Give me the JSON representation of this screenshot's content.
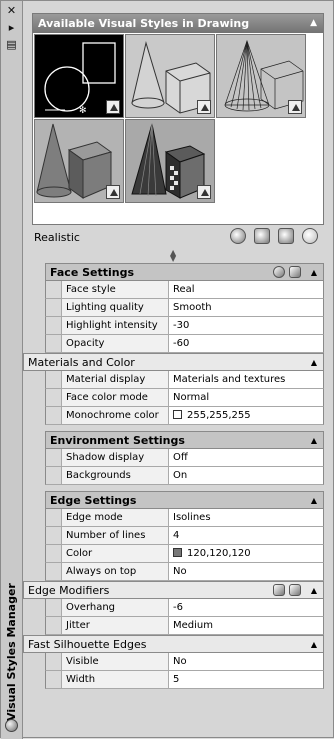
{
  "palette": {
    "title": "Visual Styles Manager",
    "close_glyph": "✕",
    "autohide_glyph": "▸",
    "menu_glyph": "▤"
  },
  "gallery": {
    "title": "Available Visual Styles in Drawing",
    "collapse_glyph": "▲",
    "selected_style": "Realistic",
    "thumbnails": [
      {
        "name": "2D Wireframe",
        "icon": "wireframe-2d-thumbnail",
        "selected": true
      },
      {
        "name": "3D Hidden",
        "icon": "hidden-3d-thumbnail"
      },
      {
        "name": "3D Wireframe",
        "icon": "wireframe-3d-thumbnail"
      },
      {
        "name": "Conceptual",
        "icon": "conceptual-thumbnail"
      },
      {
        "name": "Realistic",
        "icon": "realistic-thumbnail"
      }
    ],
    "tools": [
      "create-new-visual-style-icon",
      "apply-to-viewport-icon",
      "export-to-tool-palette-icon",
      "delete-visual-style-icon"
    ]
  },
  "sections": {
    "face": {
      "title": "Face Settings",
      "rows": [
        {
          "label": "Face style",
          "value": "Real"
        },
        {
          "label": "Lighting quality",
          "value": "Smooth"
        },
        {
          "label": "Highlight intensity",
          "value": "-30"
        },
        {
          "label": "Opacity",
          "value": "-60"
        }
      ]
    },
    "materials": {
      "title": "Materials and Color",
      "rows": [
        {
          "label": "Material display",
          "value": "Materials and textures"
        },
        {
          "label": "Face color mode",
          "value": "Normal"
        },
        {
          "label": "Monochrome color",
          "value": "255,255,255"
        }
      ]
    },
    "environment": {
      "title": "Environment Settings",
      "rows": [
        {
          "label": "Shadow display",
          "value": "Off"
        },
        {
          "label": "Backgrounds",
          "value": "On"
        }
      ]
    },
    "edge": {
      "title": "Edge Settings",
      "rows": [
        {
          "label": "Edge mode",
          "value": "Isolines"
        },
        {
          "label": "Number of lines",
          "value": "4"
        },
        {
          "label": "Color",
          "value": "120,120,120"
        },
        {
          "label": "Always on top",
          "value": "No"
        }
      ]
    },
    "modifiers": {
      "title": "Edge Modifiers",
      "rows": [
        {
          "label": "Overhang",
          "value": "-6"
        },
        {
          "label": "Jitter",
          "value": "Medium"
        }
      ]
    },
    "silhouette": {
      "title": "Fast Silhouette Edges",
      "rows": [
        {
          "label": "Visible",
          "value": "No"
        },
        {
          "label": "Width",
          "value": "5"
        }
      ]
    }
  },
  "colors": {
    "monochrome_swatch": "#ffffff",
    "edge_swatch": "#787878"
  },
  "collapse_glyph": "▲"
}
